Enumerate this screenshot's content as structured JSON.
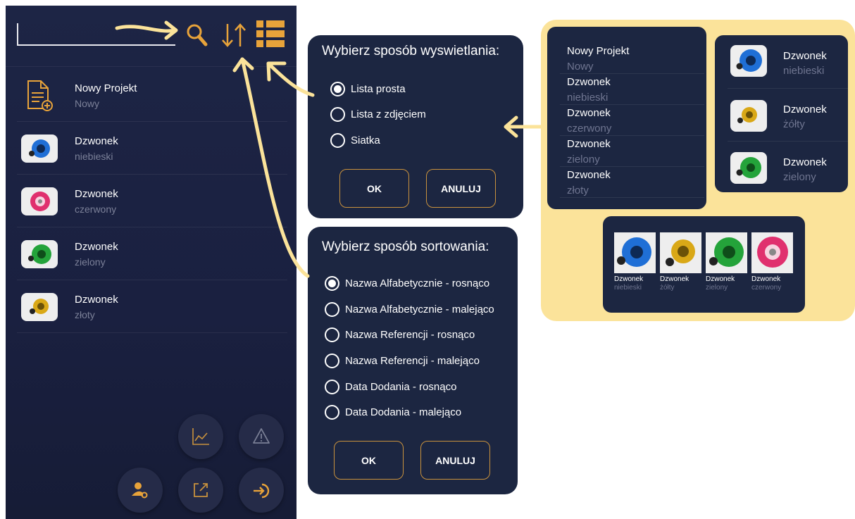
{
  "colors": {
    "accent": "#e8a33a",
    "panel": "#1c2641",
    "phone_bg": "#1d2545",
    "highlight": "#fbe39a",
    "text_secondary": "#7b8098"
  },
  "phone": {
    "search": {
      "value": "",
      "placeholder": ""
    },
    "header_icons": [
      "search-icon",
      "sort-icon",
      "view-mode-icon"
    ],
    "items": [
      {
        "title": "Nowy Projekt",
        "subtitle": "Nowy",
        "icon": "new-document-icon"
      },
      {
        "title": "Dzwonek",
        "subtitle": "niebieski",
        "color": "#1f6fd6"
      },
      {
        "title": "Dzwonek",
        "subtitle": "czerwony",
        "color": "#e0306e"
      },
      {
        "title": "Dzwonek",
        "subtitle": "zielony",
        "color": "#24a33a"
      },
      {
        "title": "Dzwonek",
        "subtitle": "złoty",
        "color": "#d9a817"
      }
    ],
    "fab_icons": [
      "chart-icon",
      "warning-icon",
      "user-settings-icon",
      "share-icon",
      "login-icon"
    ]
  },
  "display_dialog": {
    "title": "Wybierz sposób wyswietlania:",
    "options": [
      "Lista prosta",
      "Lista z zdjęciem",
      "Siatka"
    ],
    "selected_index": 0,
    "ok_label": "OK",
    "cancel_label": "ANULUJ"
  },
  "sort_dialog": {
    "title": "Wybierz sposób sortowania:",
    "options": [
      "Nazwa Alfabetycznie - rosnąco",
      "Nazwa Alfabetycznie - malejąco",
      "Nazwa Referencji - rosnąco",
      "Nazwa Referencji - malejąco",
      "Data Dodania - rosnąco",
      "Data Dodania - malejąco"
    ],
    "selected_index": 0,
    "ok_label": "OK",
    "cancel_label": "ANULUJ"
  },
  "preview": {
    "plain_list": [
      {
        "title": "Nowy Projekt",
        "subtitle": "Nowy"
      },
      {
        "title": "Dzwonek",
        "subtitle": "niebieski"
      },
      {
        "title": "Dzwonek",
        "subtitle": "czerwony"
      },
      {
        "title": "Dzwonek",
        "subtitle": "zielony"
      },
      {
        "title": "Dzwonek",
        "subtitle": "złoty"
      }
    ],
    "photo_list": [
      {
        "title": "Dzwonek",
        "subtitle": "niebieski",
        "color": "#1f6fd6"
      },
      {
        "title": "Dzwonek",
        "subtitle": "żółty",
        "color": "#d9a817"
      },
      {
        "title": "Dzwonek",
        "subtitle": "zielony",
        "color": "#24a33a"
      }
    ],
    "grid": [
      {
        "title": "Dzwonek",
        "subtitle": "niebieski",
        "color": "#1f6fd6"
      },
      {
        "title": "Dzwonek",
        "subtitle": "żółty",
        "color": "#d9a817"
      },
      {
        "title": "Dzwonek",
        "subtitle": "zielony",
        "color": "#24a33a"
      },
      {
        "title": "Dzwonek",
        "subtitle": "czerwony",
        "color": "#e0306e"
      }
    ]
  }
}
